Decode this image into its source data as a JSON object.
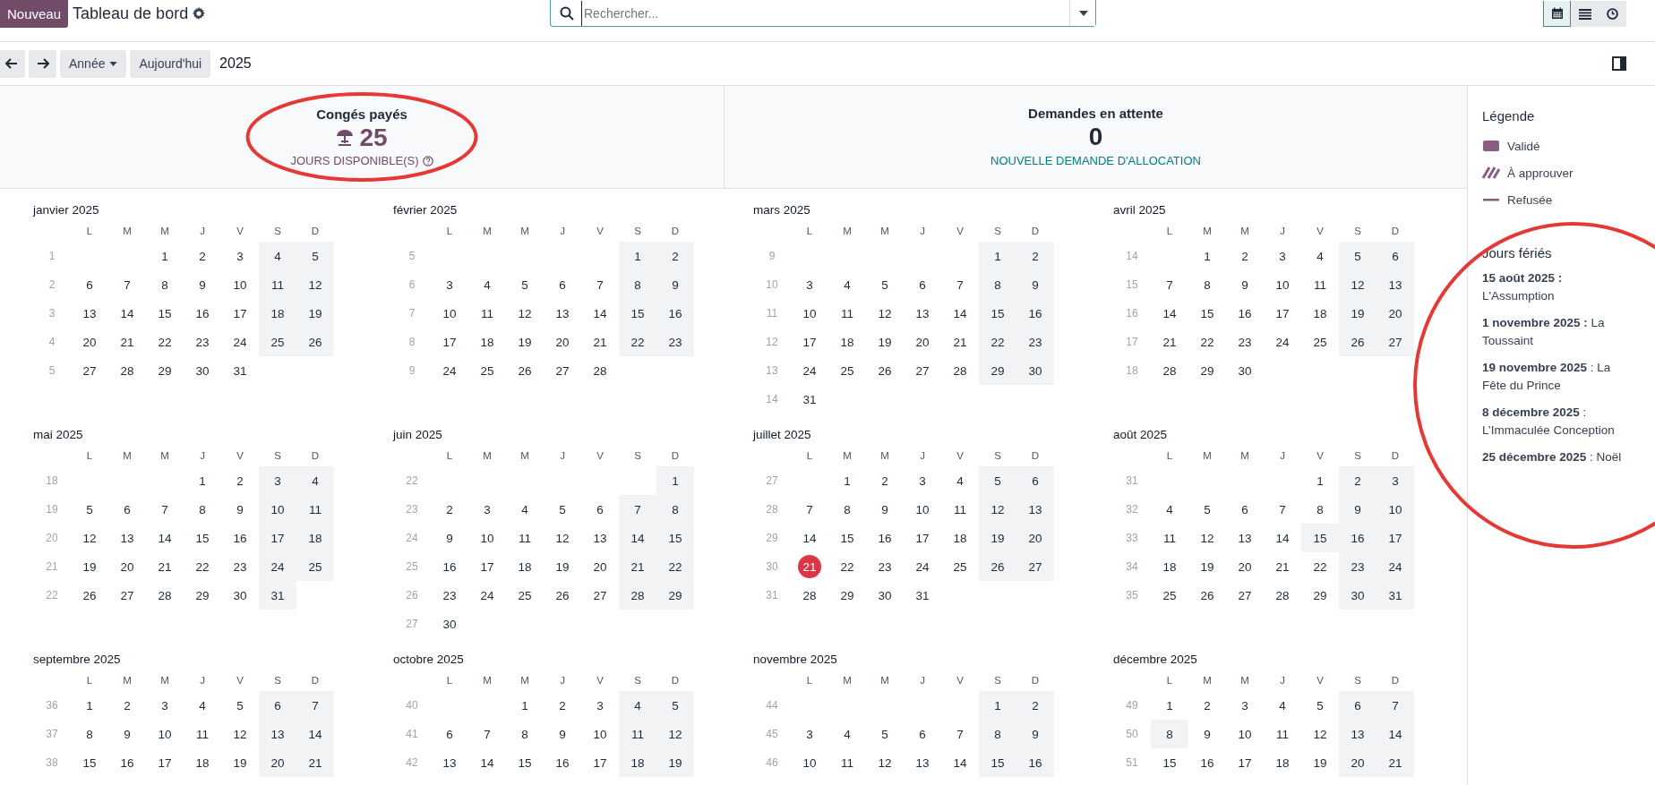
{
  "header": {
    "new_button": "Nouveau",
    "title": "Tableau de bord",
    "search": {
      "placeholder": "Rechercher..."
    },
    "views": [
      {
        "kind": "calendar",
        "selected": true
      },
      {
        "kind": "list",
        "selected": false
      },
      {
        "kind": "activity",
        "selected": false
      }
    ]
  },
  "toolbar": {
    "scale": "Année",
    "today": "Aujourd'hui",
    "period": "2025"
  },
  "summary": [
    {
      "kind": "balance",
      "title": "Congés payés",
      "value": "25",
      "caption": "JOURS DISPONIBLE(S)"
    },
    {
      "kind": "pending",
      "title": "Demandes en attente",
      "value": "0",
      "caption": "NOUVELLE DEMANDE D'ALLOCATION"
    }
  ],
  "months": [
    {
      "title": "janvier 2025",
      "weekdays": [
        "L",
        "M",
        "M",
        "J",
        "V",
        "S",
        "D"
      ],
      "weeks": [
        {
          "number": "1",
          "days": [
            "1",
            "2",
            "3",
            "4",
            "5"
          ]
        },
        {
          "number": "2",
          "days": [
            "6",
            "7",
            "8",
            "9",
            "10",
            "11",
            "12"
          ]
        },
        {
          "number": "3",
          "days": [
            "13",
            "14",
            "15",
            "16",
            "17",
            "18",
            "19"
          ]
        },
        {
          "number": "4",
          "days": [
            "20",
            "21",
            "22",
            "23",
            "24",
            "25",
            "26"
          ]
        },
        {
          "number": "5",
          "days": [
            "27",
            "28",
            "29",
            "30",
            "31"
          ]
        }
      ]
    },
    {
      "title": "février 2025",
      "weekdays": [
        "L",
        "M",
        "M",
        "J",
        "V",
        "S",
        "D"
      ],
      "weeks": [
        {
          "number": "5",
          "days": [
            "1",
            "2"
          ]
        },
        {
          "number": "6",
          "days": [
            "3",
            "4",
            "5",
            "6",
            "7",
            "8",
            "9"
          ]
        },
        {
          "number": "7",
          "days": [
            "10",
            "11",
            "12",
            "13",
            "14",
            "15",
            "16"
          ]
        },
        {
          "number": "8",
          "days": [
            "17",
            "18",
            "19",
            "20",
            "21",
            "22",
            "23"
          ]
        },
        {
          "number": "9",
          "days": [
            "24",
            "25",
            "26",
            "27",
            "28"
          ]
        }
      ]
    },
    {
      "title": "mars 2025",
      "weekdays": [
        "L",
        "M",
        "M",
        "J",
        "V",
        "S",
        "D"
      ],
      "weeks": [
        {
          "number": "9",
          "days": [
            "1",
            "2"
          ]
        },
        {
          "number": "10",
          "days": [
            "3",
            "4",
            "5",
            "6",
            "7",
            "8",
            "9"
          ]
        },
        {
          "number": "11",
          "days": [
            "10",
            "11",
            "12",
            "13",
            "14",
            "15",
            "16"
          ]
        },
        {
          "number": "12",
          "days": [
            "17",
            "18",
            "19",
            "20",
            "21",
            "22",
            "23"
          ]
        },
        {
          "number": "13",
          "days": [
            "24",
            "25",
            "26",
            "27",
            "28",
            "29",
            "30"
          ]
        },
        {
          "number": "14",
          "days": [
            "31"
          ]
        }
      ]
    },
    {
      "title": "avril 2025",
      "weekdays": [
        "L",
        "M",
        "M",
        "J",
        "V",
        "S",
        "D"
      ],
      "weeks": [
        {
          "number": "14",
          "days": [
            "1",
            "2",
            "3",
            "4",
            "5",
            "6"
          ]
        },
        {
          "number": "15",
          "days": [
            "7",
            "8",
            "9",
            "10",
            "11",
            "12",
            "13"
          ]
        },
        {
          "number": "16",
          "days": [
            "14",
            "15",
            "16",
            "17",
            "18",
            "19",
            "20"
          ]
        },
        {
          "number": "17",
          "days": [
            "21",
            "22",
            "23",
            "24",
            "25",
            "26",
            "27"
          ]
        },
        {
          "number": "18",
          "days": [
            "28",
            "29",
            "30"
          ]
        }
      ]
    },
    {
      "title": "mai 2025",
      "weekdays": [
        "L",
        "M",
        "M",
        "J",
        "V",
        "S",
        "D"
      ],
      "weeks": [
        {
          "number": "18",
          "days": [
            "1",
            "2",
            "3",
            "4"
          ]
        },
        {
          "number": "19",
          "days": [
            "5",
            "6",
            "7",
            "8",
            "9",
            "10",
            "11"
          ]
        },
        {
          "number": "20",
          "days": [
            "12",
            "13",
            "14",
            "15",
            "16",
            "17",
            "18"
          ]
        },
        {
          "number": "21",
          "days": [
            "19",
            "20",
            "21",
            "22",
            "23",
            "24",
            "25"
          ]
        },
        {
          "number": "22",
          "days": [
            "26",
            "27",
            "28",
            "29",
            "30",
            "31"
          ]
        }
      ]
    },
    {
      "title": "juin 2025",
      "weekdays": [
        "L",
        "M",
        "M",
        "J",
        "V",
        "S",
        "D"
      ],
      "weeks": [
        {
          "number": "22",
          "days": [
            "1"
          ]
        },
        {
          "number": "23",
          "days": [
            "2",
            "3",
            "4",
            "5",
            "6",
            "7",
            "8"
          ]
        },
        {
          "number": "24",
          "days": [
            "9",
            "10",
            "11",
            "12",
            "13",
            "14",
            "15"
          ]
        },
        {
          "number": "25",
          "days": [
            "16",
            "17",
            "18",
            "19",
            "20",
            "21",
            "22"
          ]
        },
        {
          "number": "26",
          "days": [
            "23",
            "24",
            "25",
            "26",
            "27",
            "28",
            "29"
          ]
        },
        {
          "number": "27",
          "days": [
            "30"
          ]
        }
      ]
    },
    {
      "title": "juillet 2025",
      "weekdays": [
        "L",
        "M",
        "M",
        "J",
        "V",
        "S",
        "D"
      ],
      "weeks": [
        {
          "number": "27",
          "days": [
            "1",
            "2",
            "3",
            "4",
            "5",
            "6"
          ]
        },
        {
          "number": "28",
          "days": [
            "7",
            "8",
            "9",
            "10",
            "11",
            "12",
            "13"
          ]
        },
        {
          "number": "29",
          "days": [
            "14",
            "15",
            "16",
            "17",
            "18",
            "19",
            "20"
          ]
        },
        {
          "number": "30",
          "days": [
            {
              "text": "21",
              "today": true
            },
            "22",
            "23",
            "24",
            "25",
            "26",
            "27"
          ]
        },
        {
          "number": "31",
          "days": [
            "28",
            "29",
            "30",
            "31"
          ]
        }
      ]
    },
    {
      "title": "août 2025",
      "weekdays": [
        "L",
        "M",
        "M",
        "J",
        "V",
        "S",
        "D"
      ],
      "weeks": [
        {
          "number": "31",
          "days": [
            "1",
            "2",
            "3"
          ]
        },
        {
          "number": "32",
          "days": [
            "4",
            "5",
            "6",
            "7",
            "8",
            "9",
            "10"
          ]
        },
        {
          "number": "33",
          "days": [
            "11",
            "12",
            "13",
            "14",
            {
              "text": "15",
              "holiday": true
            },
            "16",
            "17"
          ]
        },
        {
          "number": "34",
          "days": [
            "18",
            "19",
            "20",
            "21",
            "22",
            "23",
            "24"
          ]
        },
        {
          "number": "35",
          "days": [
            "25",
            "26",
            "27",
            "28",
            "29",
            "30",
            "31"
          ]
        }
      ]
    },
    {
      "title": "septembre 2025",
      "weekdays": [
        "L",
        "M",
        "M",
        "J",
        "V",
        "S",
        "D"
      ],
      "weeks": [
        {
          "number": "36",
          "days": [
            "1",
            "2",
            "3",
            "4",
            "5",
            "6",
            "7"
          ]
        },
        {
          "number": "37",
          "days": [
            "8",
            "9",
            "10",
            "11",
            "12",
            "13",
            "14"
          ]
        },
        {
          "number": "38",
          "days": [
            "15",
            "16",
            "17",
            "18",
            "19",
            "20",
            "21"
          ]
        }
      ]
    },
    {
      "title": "octobre 2025",
      "weekdays": [
        "L",
        "M",
        "M",
        "J",
        "V",
        "S",
        "D"
      ],
      "weeks": [
        {
          "number": "40",
          "days": [
            "1",
            "2",
            "3",
            "4",
            "5"
          ]
        },
        {
          "number": "41",
          "days": [
            "6",
            "7",
            "8",
            "9",
            "10",
            "11",
            "12"
          ]
        },
        {
          "number": "42",
          "days": [
            "13",
            "14",
            "15",
            "16",
            "17",
            "18",
            "19"
          ]
        }
      ]
    },
    {
      "title": "novembre 2025",
      "weekdays": [
        "L",
        "M",
        "M",
        "J",
        "V",
        "S",
        "D"
      ],
      "weeks": [
        {
          "number": "44",
          "days": [
            "1",
            "2"
          ]
        },
        {
          "number": "45",
          "days": [
            "3",
            "4",
            "5",
            "6",
            "7",
            "8",
            "9"
          ]
        },
        {
          "number": "46",
          "days": [
            "10",
            "11",
            "12",
            "13",
            "14",
            "15",
            "16"
          ]
        }
      ]
    },
    {
      "title": "décembre 2025",
      "weekdays": [
        "L",
        "M",
        "M",
        "J",
        "V",
        "S",
        "D"
      ],
      "weeks": [
        {
          "number": "49",
          "days": [
            "1",
            "2",
            "3",
            "4",
            "5",
            "6",
            "7"
          ]
        },
        {
          "number": "50",
          "days": [
            {
              "text": "8",
              "holiday": true
            },
            "9",
            "10",
            "11",
            "12",
            "13",
            "14"
          ]
        },
        {
          "number": "51",
          "days": [
            "15",
            "16",
            "17",
            "18",
            "19",
            "20",
            "21"
          ]
        }
      ]
    }
  ],
  "legend": {
    "title": "Légende",
    "items": [
      {
        "kind": "solid",
        "label": "Validé"
      },
      {
        "kind": "striped",
        "label": "À approuver"
      },
      {
        "kind": "line",
        "label": "Refusée"
      }
    ]
  },
  "holidays": {
    "title": "Jours fériés",
    "items": [
      "**15 août 2025 :** L'Assumption",
      "**1 novembre 2025 :** La Toussaint",
      "**19 novembre 2025** : La Fête du Prince",
      "**8 décembre 2025** : L’Immaculée Conception",
      "**25 décembre 2025** : Noël"
    ]
  },
  "annotations": [
    {
      "kind": "ellipse"
    },
    {
      "kind": "ellipse"
    }
  ]
}
